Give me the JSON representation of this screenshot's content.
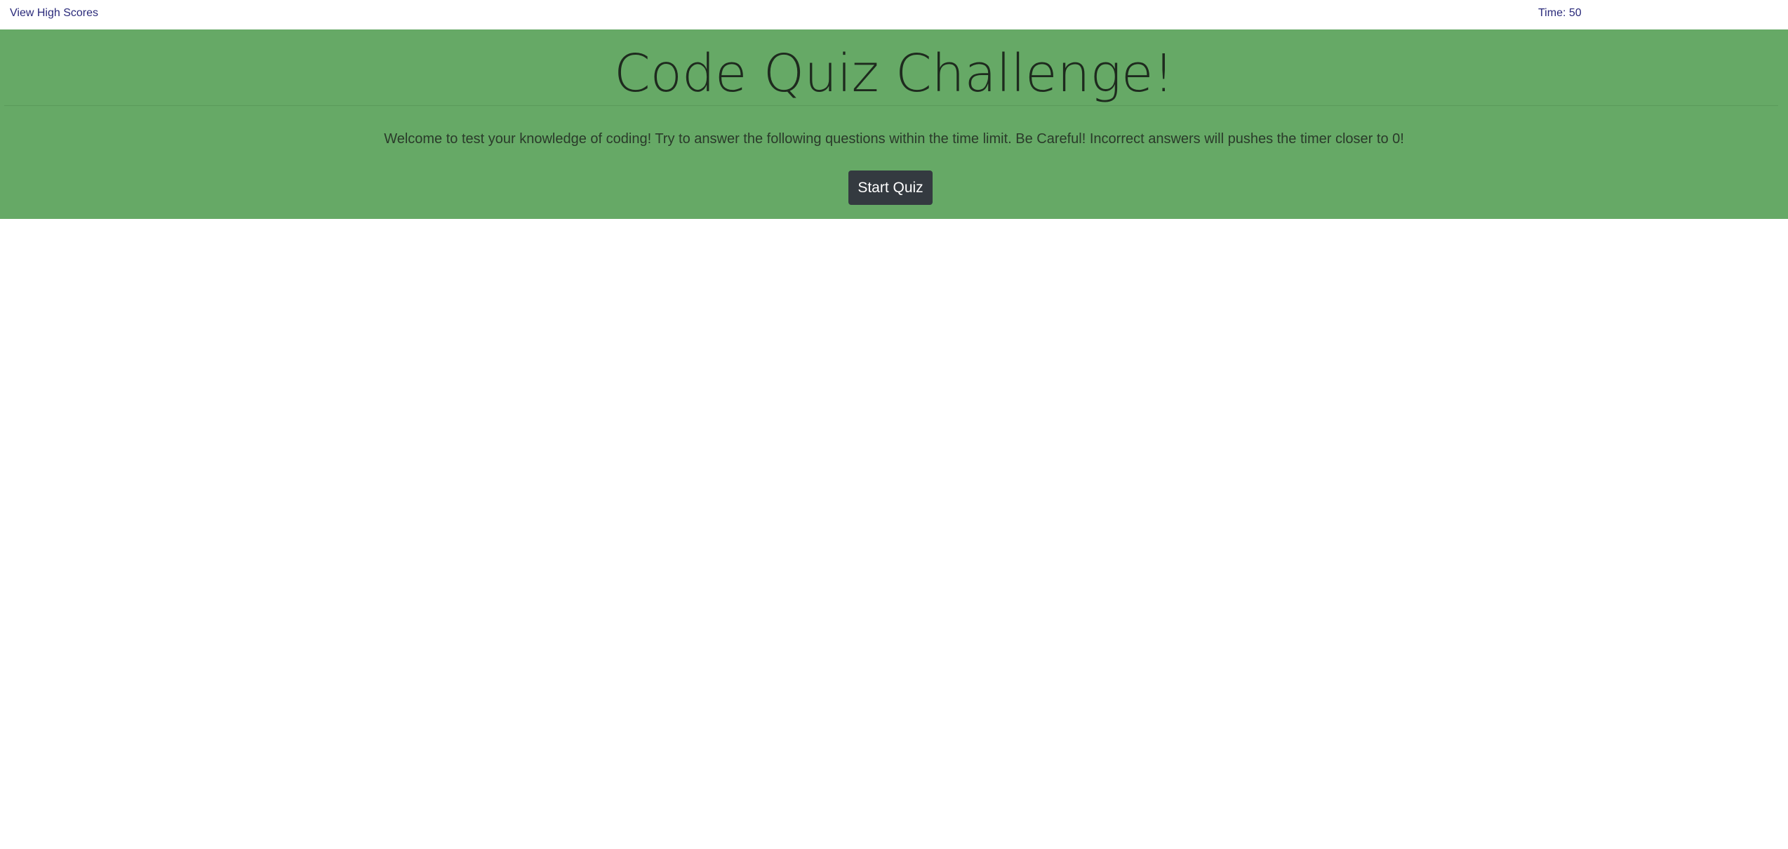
{
  "header": {
    "view_scores_label": "View High Scores",
    "timer_label": "Time: 50"
  },
  "hero": {
    "title": "Code Quiz Challenge!",
    "lead": "Welcome to test your knowledge of coding! Try to answer the following questions within the time limit. Be Careful! Incorrect answers will pushes the timer closer to 0!",
    "start_button_label": "Start Quiz"
  },
  "colors": {
    "hero_background": "#66a966",
    "button_background": "#343a40",
    "link_color": "#2a2a7a"
  }
}
